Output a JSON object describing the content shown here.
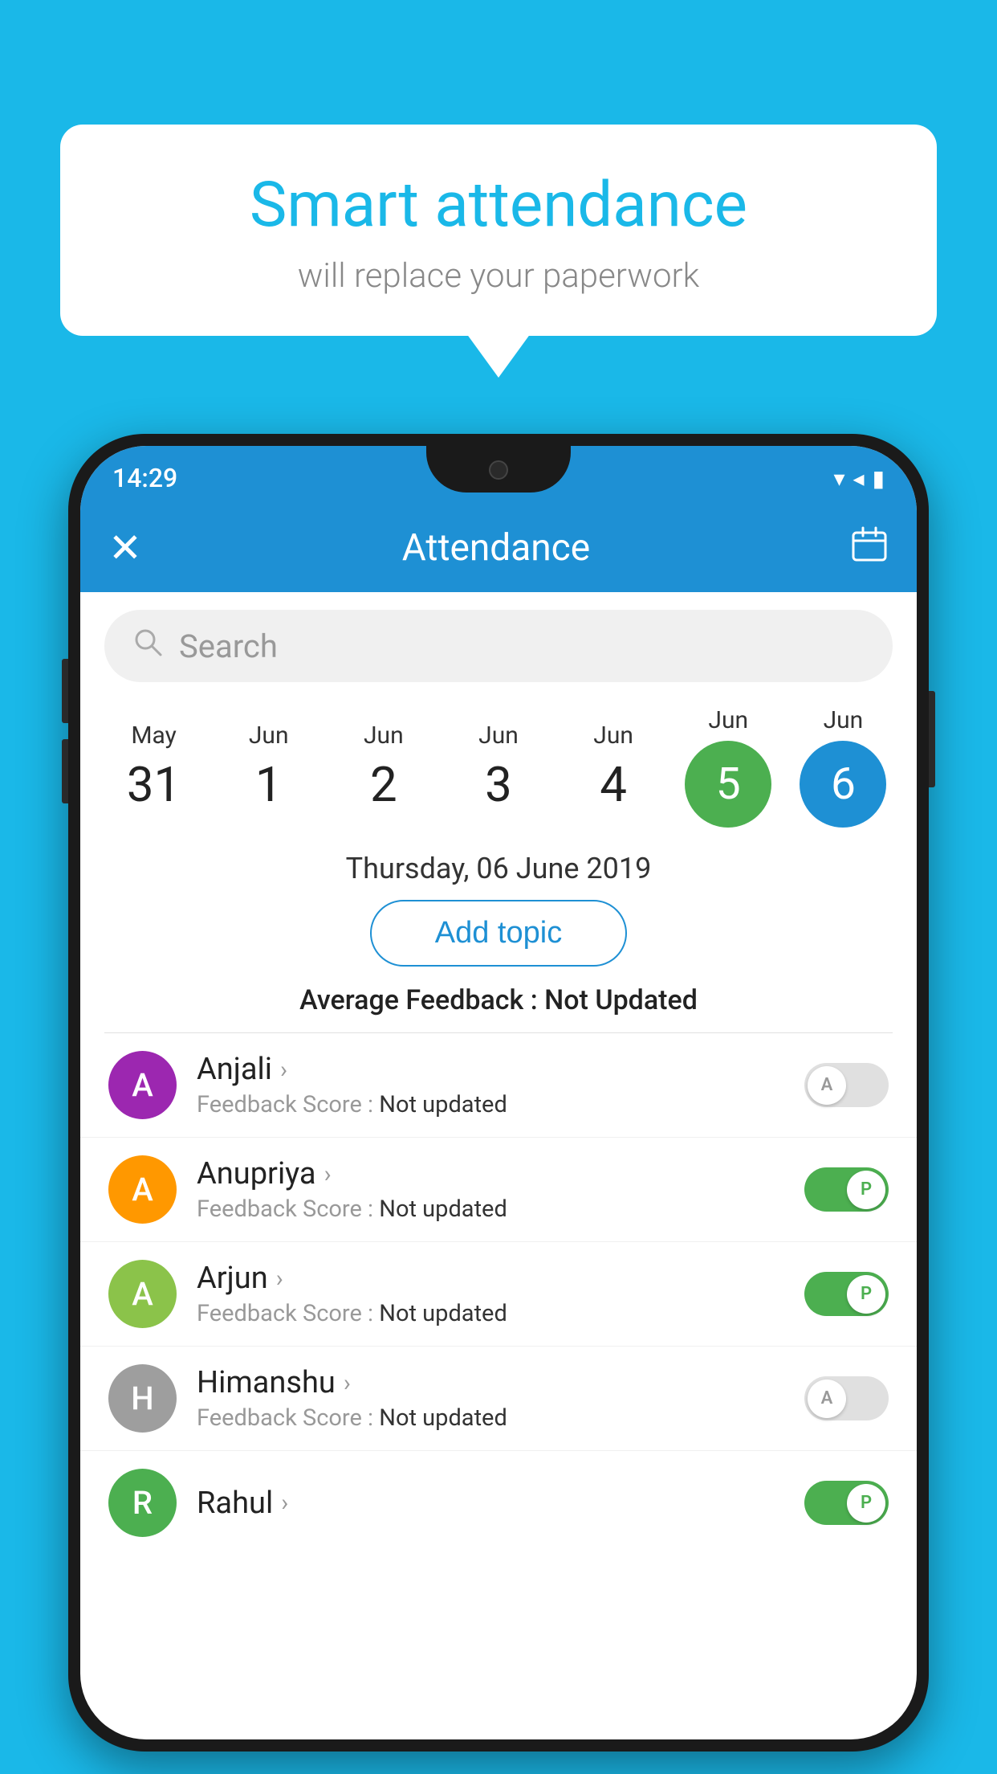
{
  "background_color": "#1ab8e8",
  "speech_bubble": {
    "title": "Smart attendance",
    "subtitle": "will replace your paperwork"
  },
  "status_bar": {
    "time": "14:29",
    "wifi_icon": "▾",
    "signal_icon": "◂",
    "battery_icon": "▮"
  },
  "app_bar": {
    "close_label": "✕",
    "title": "Attendance",
    "calendar_icon": "📅"
  },
  "search": {
    "placeholder": "Search"
  },
  "dates": [
    {
      "month": "May",
      "day": "31",
      "selected": false
    },
    {
      "month": "Jun",
      "day": "1",
      "selected": false
    },
    {
      "month": "Jun",
      "day": "2",
      "selected": false
    },
    {
      "month": "Jun",
      "day": "3",
      "selected": false
    },
    {
      "month": "Jun",
      "day": "4",
      "selected": false
    },
    {
      "month": "Jun",
      "day": "5",
      "selected": "green"
    },
    {
      "month": "Jun",
      "day": "6",
      "selected": "blue"
    }
  ],
  "selected_date_label": "Thursday, 06 June 2019",
  "add_topic_label": "Add topic",
  "average_feedback": {
    "label": "Average Feedback :",
    "value": "Not Updated"
  },
  "students": [
    {
      "name": "Anjali",
      "avatar_letter": "A",
      "avatar_color": "#9c27b0",
      "feedback_label": "Feedback Score :",
      "feedback_value": "Not updated",
      "toggle": "off",
      "toggle_letter": "A"
    },
    {
      "name": "Anupriya",
      "avatar_letter": "A",
      "avatar_color": "#ff9800",
      "feedback_label": "Feedback Score :",
      "feedback_value": "Not updated",
      "toggle": "on",
      "toggle_letter": "P"
    },
    {
      "name": "Arjun",
      "avatar_letter": "A",
      "avatar_color": "#8bc34a",
      "feedback_label": "Feedback Score :",
      "feedback_value": "Not updated",
      "toggle": "on",
      "toggle_letter": "P"
    },
    {
      "name": "Himanshu",
      "avatar_letter": "H",
      "avatar_color": "#9e9e9e",
      "feedback_label": "Feedback Score :",
      "feedback_value": "Not updated",
      "toggle": "off",
      "toggle_letter": "A"
    }
  ]
}
